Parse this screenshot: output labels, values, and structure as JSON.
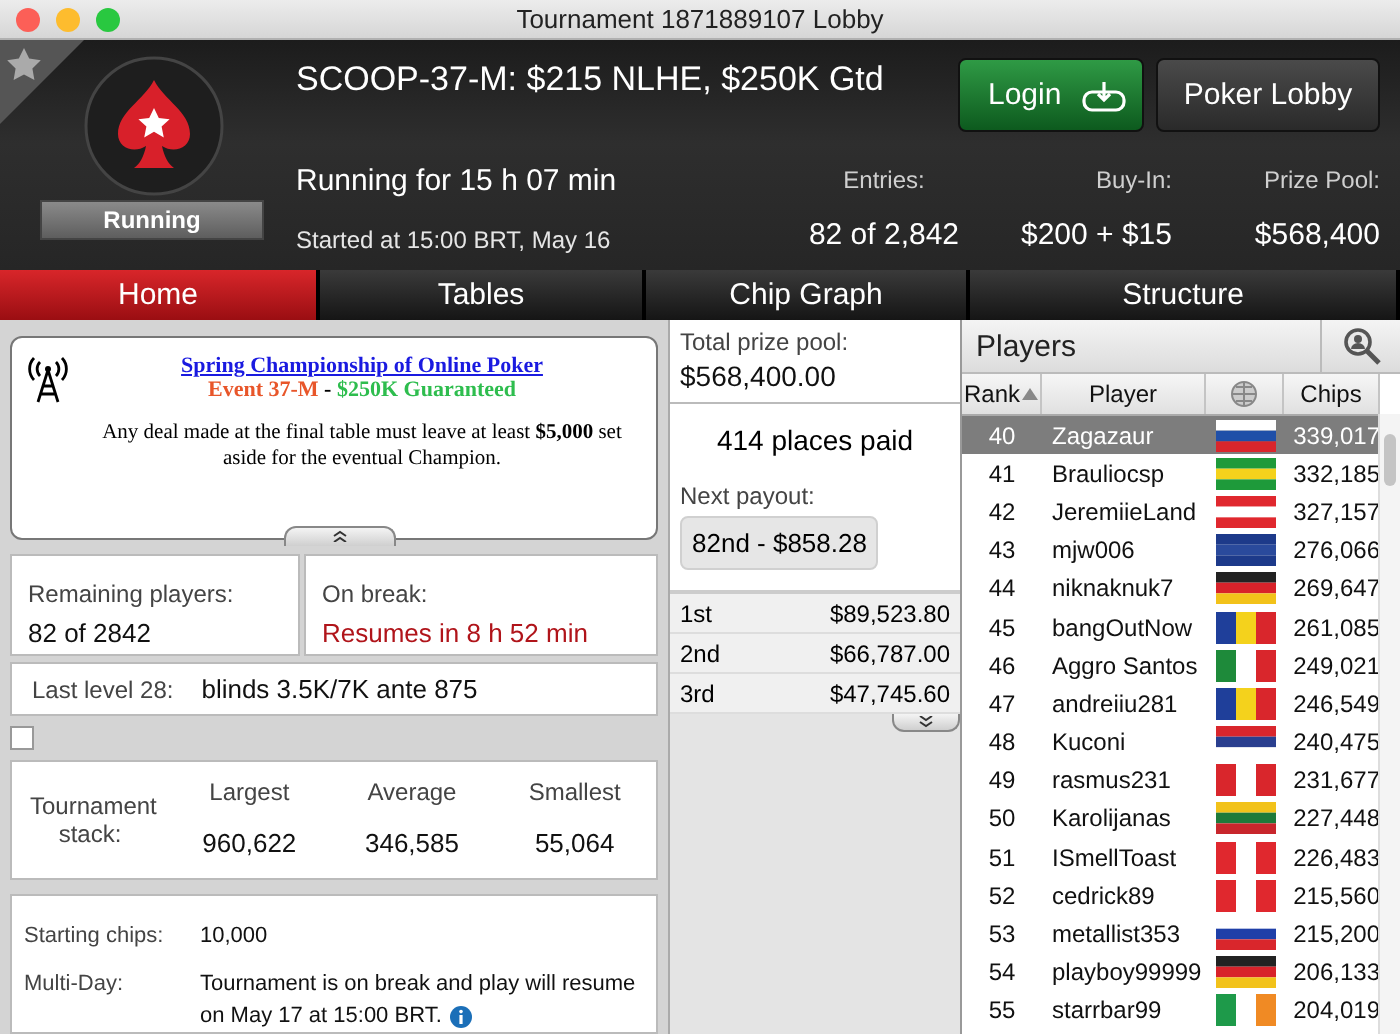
{
  "window": {
    "title": "Tournament 1871889107 Lobby"
  },
  "header": {
    "status": "Running",
    "title": "SCOOP-37-M: $215 NLHE, $250K Gtd",
    "running_for": "Running for 15 h 07 min",
    "started": "Started at 15:00 BRT, May 16",
    "buttons": [
      {
        "label": "Login",
        "kind": "login"
      },
      {
        "label": "Poker Lobby",
        "kind": "plain"
      }
    ],
    "stats": [
      {
        "label": "Entries:",
        "value": "82 of 2,842"
      },
      {
        "label": "Buy-In:",
        "value": "$200 + $15"
      },
      {
        "label": "Prize Pool:",
        "value": "$568,400"
      }
    ]
  },
  "tabs": [
    {
      "label": "Home",
      "selected": true
    },
    {
      "label": "Tables",
      "selected": false
    },
    {
      "label": "Chip Graph",
      "selected": false
    },
    {
      "label": "Structure",
      "selected": false
    }
  ],
  "notice": {
    "link": "Spring Championship of Online Poker",
    "event_line": [
      {
        "text": "Event 37-M",
        "color": "#e8562a"
      },
      {
        "text": " - ",
        "color": "#000000"
      },
      {
        "text": "$250K Guaranteed",
        "color": "#2ebd4e"
      }
    ],
    "body": "Any deal made at the final table must leave at least **$5,000** set aside for the eventual Champion."
  },
  "remaining": {
    "label": "Remaining players:",
    "value": "82 of 2842"
  },
  "break": {
    "label": "On break:",
    "value": "Resumes in 8 h 52 min"
  },
  "last_level": {
    "label": "Last level 28:",
    "value": "blinds 3.5K/7K ante 875"
  },
  "option_checkbox": {
    "checked": false
  },
  "stack": {
    "label": "Tournament stack:",
    "columns": [
      {
        "label": "Largest",
        "value": "960,622"
      },
      {
        "label": "Average",
        "value": "346,585"
      },
      {
        "label": "Smallest",
        "value": "55,064"
      }
    ]
  },
  "info": [
    {
      "label": "Starting chips:",
      "value": "10,000",
      "info_icon": false
    },
    {
      "label": "Multi-Day:",
      "value": "Tournament is on break and play will resume on May 17 at 15:00 BRT.",
      "info_icon": true
    }
  ],
  "prize": {
    "total_label": "Total prize pool:",
    "total": "$568,400.00",
    "places": "414 places paid",
    "next_label": "Next payout:",
    "next": "82nd - $858.28",
    "payouts": [
      {
        "place": "1st",
        "amount": "$89,523.80"
      },
      {
        "place": "2nd",
        "amount": "$66,787.00"
      },
      {
        "place": "3rd",
        "amount": "$47,745.60"
      }
    ]
  },
  "players": {
    "title": "Players",
    "columns": [
      "Rank",
      "Player",
      "Chips"
    ],
    "rows": [
      {
        "rank": "40",
        "name": "Zagazaur",
        "chips": "339,017",
        "selected": true,
        "flag": {
          "kind": "h",
          "stripes": [
            {
              "color": "#ffffff"
            },
            {
              "color": "#1f4fa8"
            },
            {
              "color": "#d9262c"
            }
          ]
        }
      },
      {
        "rank": "41",
        "name": "Brauliocsp",
        "chips": "332,185",
        "selected": false,
        "flag": {
          "kind": "h",
          "stripes": [
            {
              "color": "#1e9a3a"
            },
            {
              "color": "#f4d21c"
            },
            {
              "color": "#1e9a3a"
            }
          ]
        }
      },
      {
        "rank": "42",
        "name": "JeremiieLand",
        "chips": "327,157",
        "selected": false,
        "flag": {
          "kind": "h",
          "stripes": [
            {
              "color": "#e0282e"
            },
            {
              "color": "#ffffff"
            },
            {
              "color": "#e0282e"
            }
          ]
        }
      },
      {
        "rank": "43",
        "name": "mjw006",
        "chips": "276,066",
        "selected": false,
        "flag": {
          "kind": "h",
          "stripes": [
            {
              "color": "#1d3a8a"
            },
            {
              "color": "#2a4a9c"
            },
            {
              "color": "#1d3a8a"
            }
          ]
        }
      },
      {
        "rank": "44",
        "name": "niknaknuk7",
        "chips": "269,647",
        "selected": false,
        "flag": {
          "kind": "h",
          "stripes": [
            {
              "color": "#222222"
            },
            {
              "color": "#d8222a"
            },
            {
              "color": "#f2c21a"
            }
          ]
        }
      },
      {
        "rank": "45",
        "name": "bangOutNow",
        "chips": "261,085",
        "selected": false,
        "flag": {
          "kind": "v",
          "stripes": [
            {
              "color": "#1f3f9a"
            },
            {
              "color": "#f4d21c"
            },
            {
              "color": "#d9262c"
            }
          ]
        }
      },
      {
        "rank": "46",
        "name": "Aggro Santos",
        "chips": "249,021",
        "selected": false,
        "flag": {
          "kind": "v",
          "stripes": [
            {
              "color": "#1e8a3a"
            },
            {
              "color": "#ffffff"
            },
            {
              "color": "#d9262c"
            }
          ]
        }
      },
      {
        "rank": "47",
        "name": "andreiiu281",
        "chips": "246,549",
        "selected": false,
        "flag": {
          "kind": "v",
          "stripes": [
            {
              "color": "#1f3f9a"
            },
            {
              "color": "#f4d21c"
            },
            {
              "color": "#d9262c"
            }
          ]
        }
      },
      {
        "rank": "48",
        "name": "Kuconi",
        "chips": "240,475",
        "selected": false,
        "flag": {
          "kind": "h",
          "stripes": [
            {
              "color": "#d9262c"
            },
            {
              "color": "#2a3f8f"
            },
            {
              "color": "#ffffff"
            }
          ]
        }
      },
      {
        "rank": "49",
        "name": "rasmus231",
        "chips": "231,677",
        "selected": false,
        "flag": {
          "kind": "v",
          "stripes": [
            {
              "color": "#d9262c"
            },
            {
              "color": "#ffffff"
            },
            {
              "color": "#d9262c"
            }
          ]
        }
      },
      {
        "rank": "50",
        "name": "Karolijanas",
        "chips": "227,448",
        "selected": false,
        "flag": {
          "kind": "h",
          "stripes": [
            {
              "color": "#f2c21a"
            },
            {
              "color": "#1e7a3a"
            },
            {
              "color": "#c8262c"
            }
          ]
        }
      },
      {
        "rank": "51",
        "name": "ISmellToast",
        "chips": "226,483",
        "selected": false,
        "flag": {
          "kind": "v",
          "stripes": [
            {
              "color": "#e0282e"
            },
            {
              "color": "#ffffff"
            },
            {
              "color": "#e0282e"
            }
          ]
        }
      },
      {
        "rank": "52",
        "name": "cedrick89",
        "chips": "215,560",
        "selected": false,
        "flag": {
          "kind": "v",
          "stripes": [
            {
              "color": "#e0282e"
            },
            {
              "color": "#ffffff"
            },
            {
              "color": "#e0282e"
            }
          ]
        }
      },
      {
        "rank": "53",
        "name": "metallist353",
        "chips": "215,200",
        "selected": false,
        "flag": {
          "kind": "h",
          "stripes": [
            {
              "color": "#ffffff"
            },
            {
              "color": "#1f3fa8"
            },
            {
              "color": "#d9262c"
            }
          ]
        }
      },
      {
        "rank": "54",
        "name": "playboy99999",
        "chips": "206,133",
        "selected": false,
        "flag": {
          "kind": "h",
          "stripes": [
            {
              "color": "#222222"
            },
            {
              "color": "#d8222a"
            },
            {
              "color": "#f2c21a"
            }
          ]
        }
      },
      {
        "rank": "55",
        "name": "starrbar99",
        "chips": "204,019",
        "selected": false,
        "flag": {
          "kind": "v",
          "stripes": [
            {
              "color": "#1e9a4a"
            },
            {
              "color": "#ffffff"
            },
            {
              "color": "#f08a24"
            }
          ]
        }
      }
    ]
  }
}
